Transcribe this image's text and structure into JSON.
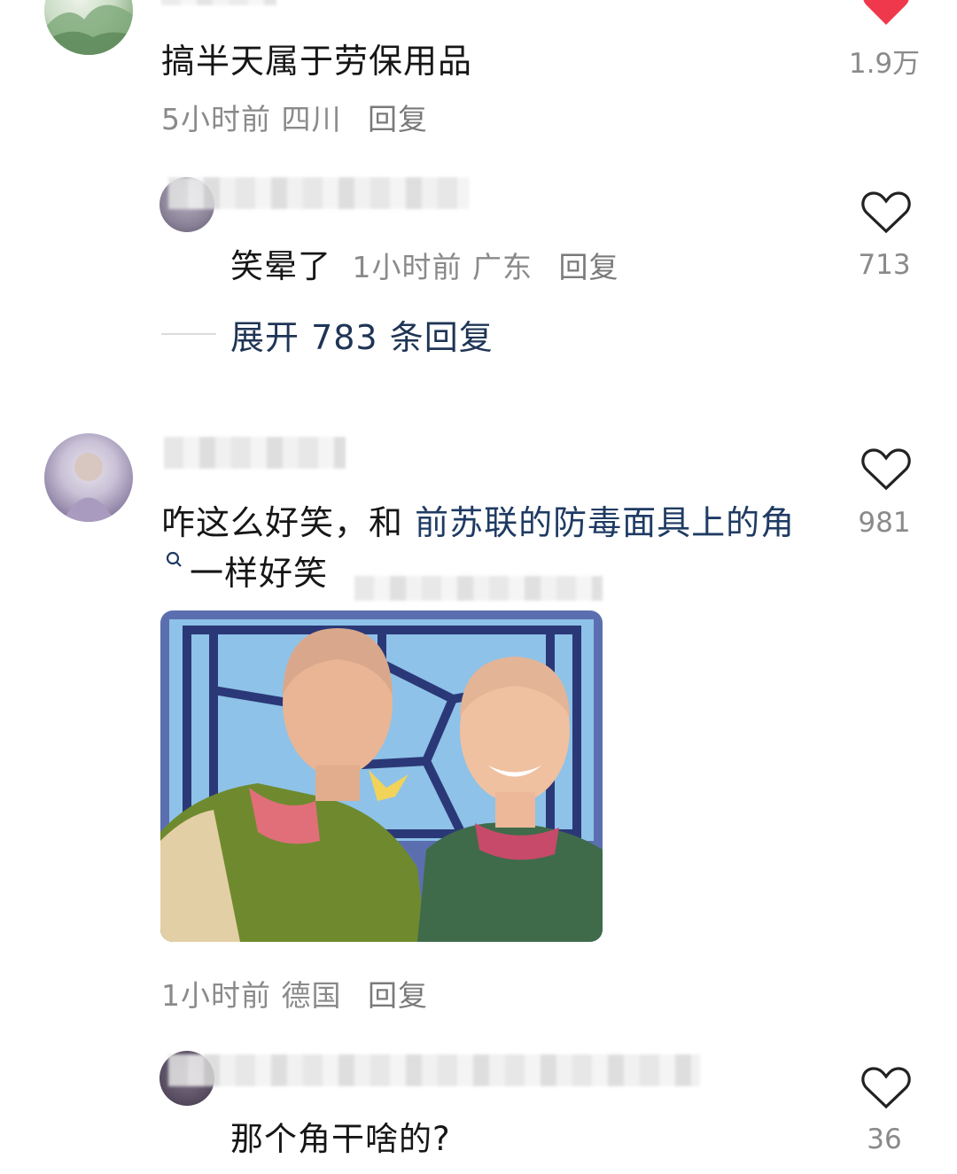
{
  "comments": [
    {
      "username": "莎格格",
      "text": "搞半天属于劳保用品",
      "time": "5小时前",
      "location": "四川",
      "reply_label": "回复",
      "likes": "1.9万",
      "liked": true,
      "replies": [
        {
          "username": "我不想工作了！",
          "text": "笑晕了",
          "time": "1小时前",
          "location": "广东",
          "reply_label": "回复",
          "likes": "713"
        }
      ],
      "expand_label": "展开 783 条回复"
    },
    {
      "text_part1": "咋这么好笑，和 ",
      "text_link": "前苏联的防毒面具上的角",
      "text_part2": "一样好笑",
      "time": "1小时前",
      "location": "德国",
      "reply_label": "回复",
      "likes": "981",
      "liked": false,
      "replies": [
        {
          "text": "那个角干啥的?",
          "likes": "36"
        }
      ]
    }
  ],
  "colors": {
    "liked_heart": "#f0384c",
    "link": "#1f3b63",
    "meta": "#8a8a8a"
  },
  "icons": {
    "like": "heart-icon",
    "search_hint": "search-hint-icon"
  }
}
